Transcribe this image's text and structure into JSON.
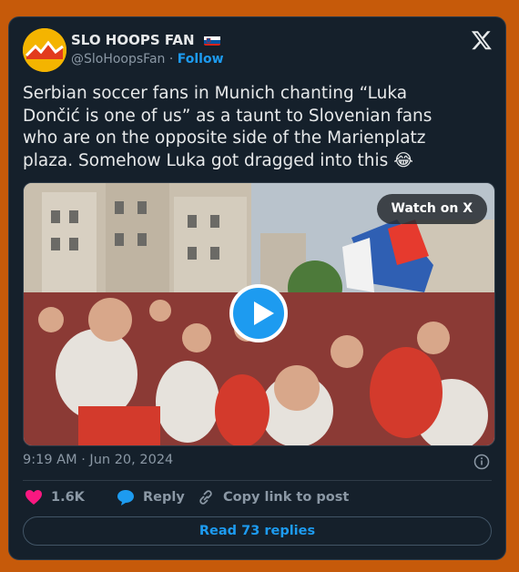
{
  "author": {
    "name": "SLO HOOPS FAN",
    "handle": "@SloHoopsFan",
    "separator": "·",
    "follow_label": "Follow"
  },
  "post": {
    "text": "Serbian soccer fans in Munich chanting “Luka\nDončić is one of us” as a taunt to Slovenian fans\nwho are on the opposite side of the Marienplatz\nplaza. Somehow Luka got dragged into this 😂",
    "timestamp": "9:19 AM · Jun 20, 2024"
  },
  "media": {
    "watch_label": "Watch on X"
  },
  "actions": {
    "likes_count": "1.6K",
    "reply_label": "Reply",
    "copy_link_label": "Copy link to post"
  },
  "read_replies_label": "Read 73 replies",
  "colors": {
    "background": "#c65a0a",
    "card": "#15202b",
    "accent": "#1d9bf0",
    "like": "#f91880"
  }
}
